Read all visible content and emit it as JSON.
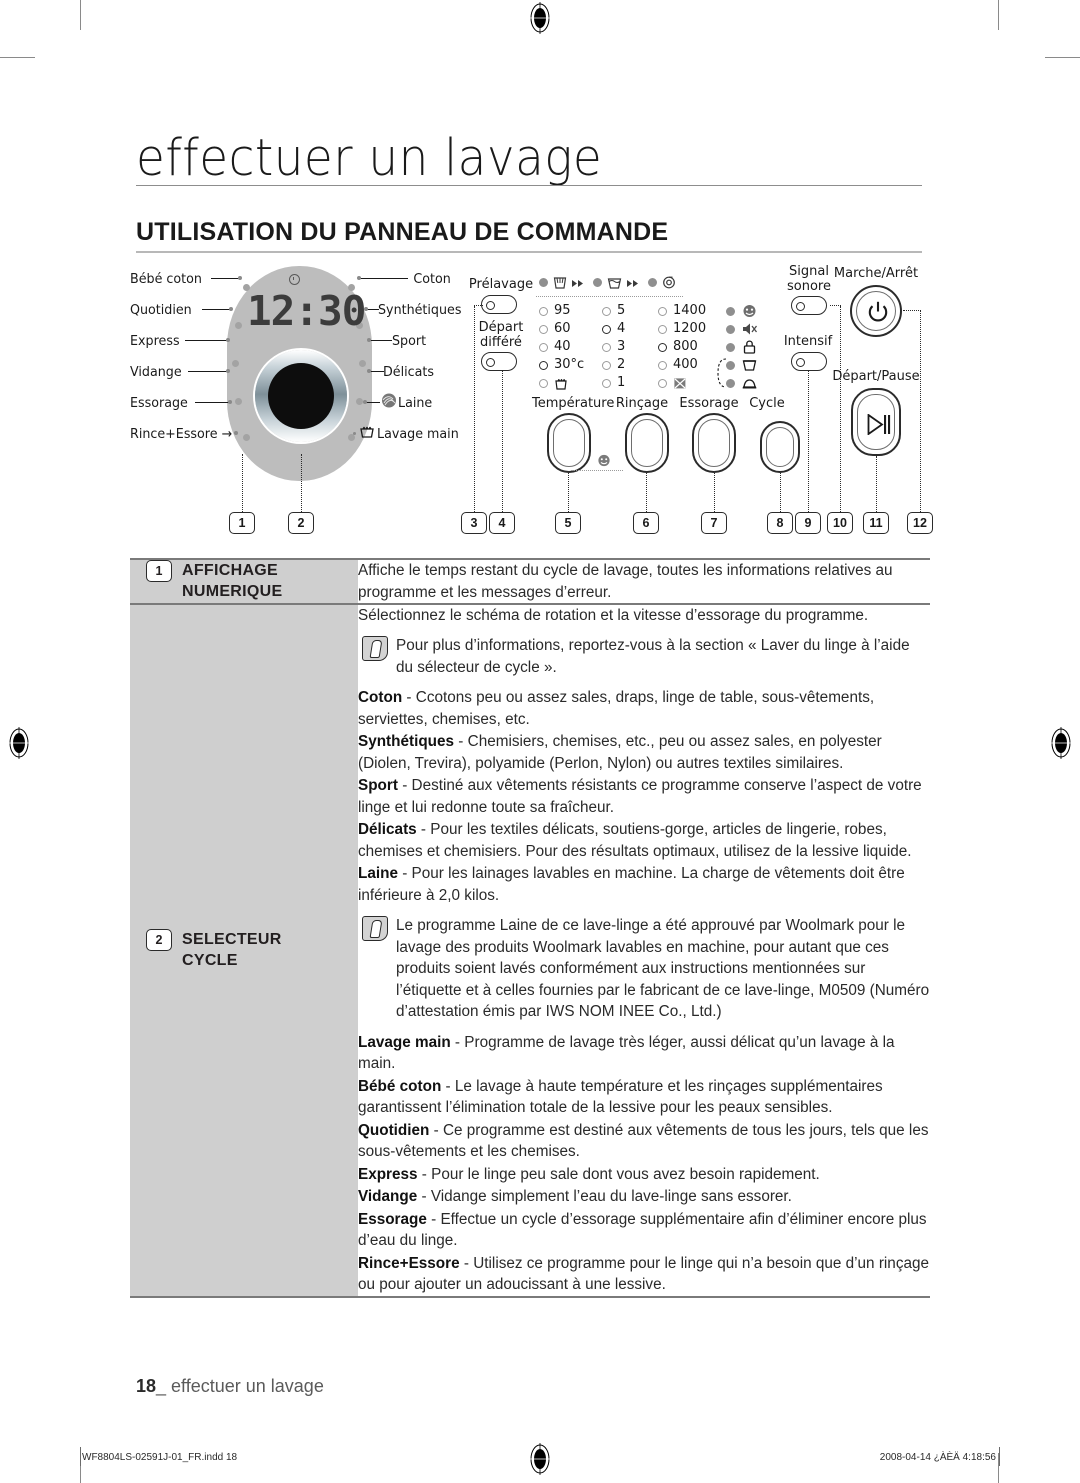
{
  "header": {
    "chapter_title": "effectuer un lavage",
    "section_title": "UTILISATION DU PANNEAU DE COMMANDE"
  },
  "diagram": {
    "lcd_value": "12:30",
    "left_labels": [
      "Bébé coton",
      "Quotidien",
      "Express",
      "Vidange",
      "Essorage",
      "Rince+Essore →"
    ],
    "right_labels": [
      "Coton",
      "Synthétiques",
      "Sport",
      "Délicats",
      "Laine",
      "Lavage main"
    ],
    "toggles": [
      {
        "label": "Prélavage"
      },
      {
        "label": "Départ\ndifféré"
      },
      {
        "label": "Signal\nsonore"
      },
      {
        "label": "Intensif"
      }
    ],
    "toggle_prelavage": "Prélavage",
    "toggle_depart_differe_l1": "Départ",
    "toggle_depart_differe_l2": "différé",
    "toggle_signal_l1": "Signal",
    "toggle_signal_l2": "sonore",
    "toggle_intensif": "Intensif",
    "progress_icons": [
      "wash-icon",
      "rinse-icon",
      "spin-icon"
    ],
    "led_columns": [
      {
        "header": "Température",
        "values": [
          "95",
          "60",
          "40",
          "30°c",
          "hand-wash-icon"
        ]
      },
      {
        "header": "Rinçage",
        "values": [
          "5",
          "4",
          "3",
          "2",
          "1"
        ]
      },
      {
        "header": "Essorage",
        "values": [
          "1400",
          "1200",
          "800",
          "400",
          "no-spin-icon"
        ]
      },
      {
        "header": "Cycle",
        "values": [
          "smile-icon",
          "mute-icon",
          "lock-icon",
          "rinse-hold-icon",
          "iron-icon"
        ]
      }
    ],
    "buttons": [
      {
        "label": "Température"
      },
      {
        "label": "Rinçage"
      },
      {
        "label": "Essorage"
      },
      {
        "label": "Cycle"
      },
      {
        "label": "Marche/Arrêt"
      },
      {
        "label": "Départ/Pause"
      }
    ],
    "btn_temperature": "Température",
    "btn_rincage": "Rinçage",
    "btn_essorage": "Essorage",
    "btn_cycle": "Cycle",
    "btn_power": "Marche/Arrêt",
    "btn_start": "Départ/Pause",
    "callout_numbers": [
      "1",
      "2",
      "3",
      "4",
      "5",
      "6",
      "7",
      "8",
      "9",
      "10",
      "11",
      "12"
    ]
  },
  "table": {
    "rows": [
      {
        "index": "1",
        "label_line1": "AFFICHAGE",
        "label_line2": "NUMERIQUE",
        "paragraphs": [
          {
            "type": "text",
            "text": "Affiche le temps restant du cycle de lavage, toutes les informations relatives au programme et les messages d’erreur."
          }
        ]
      },
      {
        "index": "2",
        "label_line1": "SELECTEUR",
        "label_line2": "CYCLE",
        "paragraphs": [
          {
            "type": "text",
            "text": "Sélectionnez le schéma de rotation et la vitesse d’essorage du programme."
          },
          {
            "type": "note",
            "text": "Pour plus d’informations, reportez-vous à la section « Laver du linge à l’aide du sélecteur de cycle »."
          },
          {
            "type": "term",
            "term": "Coton",
            "text": " - Ccotons peu ou assez sales, draps, linge de table, sous-vêtements, serviettes, chemises, etc."
          },
          {
            "type": "term",
            "term": "Synthétiques",
            "text": " - Chemisiers, chemises, etc., peu ou assez sales, en polyester (Diolen, Trevira), polyamide (Perlon, Nylon) ou autres textiles similaires."
          },
          {
            "type": "term",
            "term": "Sport",
            "text": " - Destiné aux vêtements résistants ce programme conserve l’aspect de votre linge et lui redonne toute sa fraîcheur."
          },
          {
            "type": "term",
            "term": "Délicats",
            "text": " - Pour les textiles délicats, soutiens-gorge, articles de lingerie, robes, chemises et chemisiers. Pour des résultats optimaux, utilisez de la lessive liquide."
          },
          {
            "type": "term",
            "term": "Laine",
            "text": " - Pour les lainages lavables en machine. La charge de vêtements doit être inférieure à 2,0 kilos."
          },
          {
            "type": "note",
            "text": "Le programme Laine de ce lave-linge a été approuvé par Woolmark pour le lavage des produits Woolmark lavables en machine, pour autant que ces produits soient lavés conformément aux instructions mentionnées sur l’étiquette et à celles fournies par le fabricant de ce lave-linge, M0509 (Numéro d’attestation émis par IWS NOM INEE Co., Ltd.)"
          },
          {
            "type": "term",
            "term": "Lavage main",
            "text": " - Programme de lavage très léger, aussi délicat qu’un lavage à la main."
          },
          {
            "type": "term",
            "term": "Bébé coton",
            "text": " - Le lavage à haute température et les rinçages supplémentaires garantissent l’élimination totale de la lessive pour les peaux sensibles."
          },
          {
            "type": "term",
            "term": "Quotidien",
            "text": " - Ce programme est destiné aux vêtements de tous les jours, tels que les sous-vêtements et les chemises."
          },
          {
            "type": "term",
            "term": "Express",
            "text": " - Pour le linge peu sale dont vous avez besoin rapidement."
          },
          {
            "type": "term",
            "term": "Vidange",
            "text": " - Vidange simplement l’eau du lave-linge sans essorer."
          },
          {
            "type": "term",
            "term": "Essorage",
            "text": " - Effectue un cycle d’essorage supplémentaire afin d’éliminer encore plus d’eau du linge."
          },
          {
            "type": "term",
            "term": "Rince+Essore",
            "text": " - Utilisez ce programme pour le linge qui n’a besoin que d’un rinçage ou pour ajouter un adoucissant à une lessive."
          }
        ]
      }
    ]
  },
  "footer": {
    "page_number": "18",
    "running_title": "effectuer un lavage",
    "imprint_file": "WF8804LS-02591J-01_FR.indd   18",
    "imprint_date": "2008-04-14   ¿ÀÈÄ 4:18:56"
  },
  "colors": {
    "panel_gray": "#bdbdbd",
    "table_label_bg": "#cfcfcf",
    "rule": "#7a7a7a",
    "text": "#231f20"
  }
}
